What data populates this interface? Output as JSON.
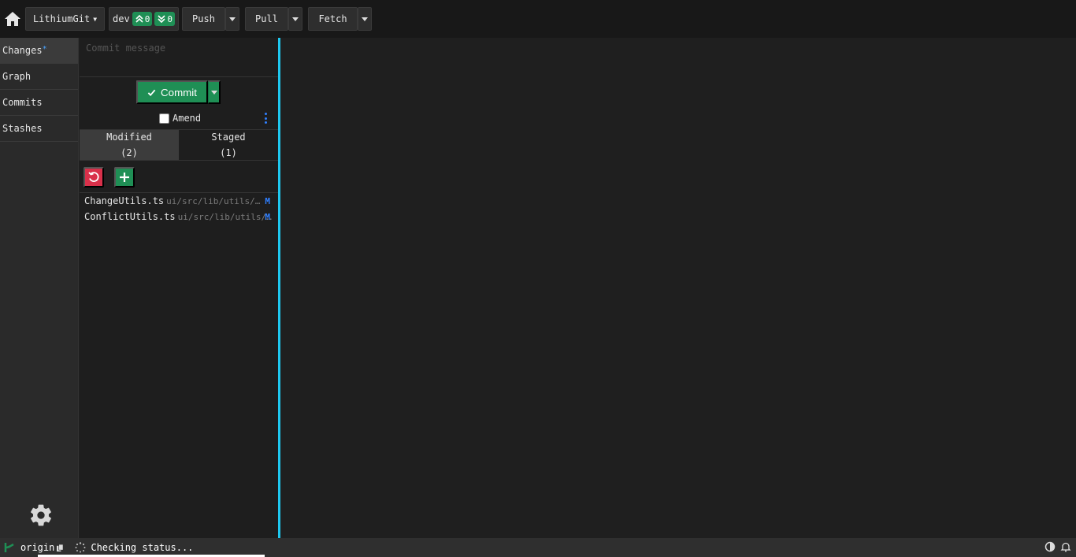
{
  "toolbar": {
    "repo_label": "LithiumGit",
    "branch_name": "dev",
    "ahead_count": "0",
    "behind_count": "0",
    "push_label": "Push",
    "pull_label": "Pull",
    "fetch_label": "Fetch"
  },
  "sidebar": {
    "items": [
      {
        "label": "Changes",
        "marker": "*"
      },
      {
        "label": "Graph"
      },
      {
        "label": "Commits"
      },
      {
        "label": "Stashes"
      }
    ]
  },
  "changes": {
    "commit_message_placeholder": "Commit message",
    "commit_label": "Commit",
    "amend_label": "Amend",
    "tabs": [
      {
        "label": "Modified",
        "count": "(2)"
      },
      {
        "label": "Staged",
        "count": "(1)"
      }
    ],
    "files": [
      {
        "name": "ChangeUtils.ts",
        "path": "ui/src/lib/utils/ChangeUtils.ts",
        "status": "M"
      },
      {
        "name": "ConflictUtils.ts",
        "path": "ui/src/lib/utils/ConflictUtils.ts",
        "status": "M"
      }
    ]
  },
  "statusbar": {
    "remote": "origin",
    "status_text": "Checking status..."
  },
  "colors": {
    "accent_green": "#1f8f55",
    "danger_red": "#d9304a",
    "divider_cyan": "#1ec8f0",
    "modified_blue": "#2f7fff"
  }
}
